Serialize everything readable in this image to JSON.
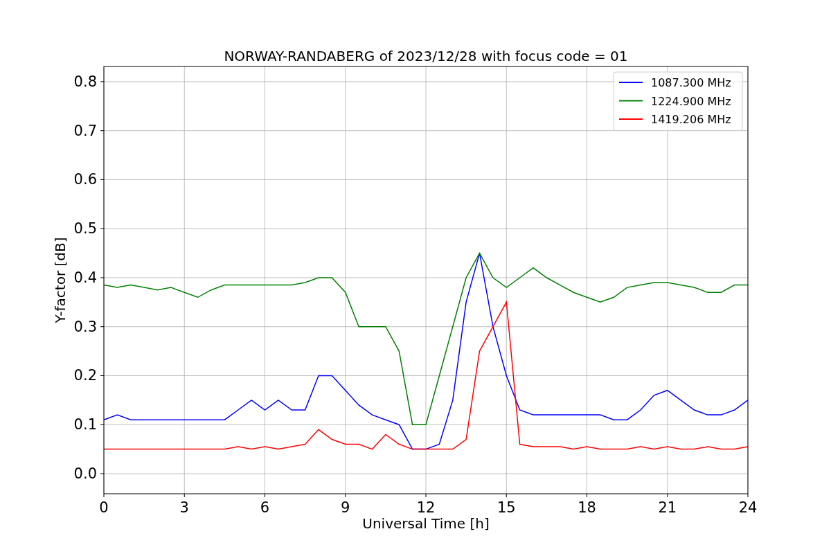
{
  "chart_data": {
    "type": "line",
    "title": "NORWAY-RANDABERG of 2023/12/28 with focus code = 01",
    "xlabel": "Universal Time [h]",
    "ylabel": "Y-factor [dB]",
    "x": [
      0,
      0.5,
      1,
      1.5,
      2,
      2.5,
      3,
      3.5,
      4,
      4.5,
      5,
      5.5,
      6,
      6.5,
      7,
      7.5,
      8,
      8.5,
      9,
      9.5,
      10,
      10.5,
      11,
      11.5,
      12,
      12.5,
      13,
      13.5,
      14,
      14.5,
      15,
      15.5,
      16,
      16.5,
      17,
      17.5,
      18,
      18.5,
      19,
      19.5,
      20,
      20.5,
      21,
      21.5,
      22,
      22.5,
      23,
      23.5,
      24
    ],
    "series": [
      {
        "name": "1087.300 MHz",
        "color": "#0000ff",
        "values": [
          0.11,
          0.12,
          0.11,
          0.11,
          0.11,
          0.11,
          0.11,
          0.11,
          0.11,
          0.11,
          0.13,
          0.15,
          0.13,
          0.15,
          0.13,
          0.13,
          0.2,
          0.2,
          0.17,
          0.14,
          0.12,
          0.11,
          0.1,
          0.05,
          0.05,
          0.06,
          0.15,
          0.35,
          0.45,
          0.3,
          0.2,
          0.13,
          0.12,
          0.12,
          0.12,
          0.12,
          0.12,
          0.12,
          0.11,
          0.11,
          0.13,
          0.16,
          0.17,
          0.15,
          0.13,
          0.12,
          0.12,
          0.13,
          0.15
        ]
      },
      {
        "name": "1224.900 MHz",
        "color": "#008000",
        "values": [
          0.385,
          0.38,
          0.385,
          0.38,
          0.375,
          0.38,
          0.37,
          0.36,
          0.375,
          0.385,
          0.385,
          0.385,
          0.385,
          0.385,
          0.385,
          0.39,
          0.4,
          0.4,
          0.37,
          0.3,
          0.3,
          0.3,
          0.25,
          0.1,
          0.1,
          0.2,
          0.3,
          0.4,
          0.45,
          0.4,
          0.38,
          0.4,
          0.42,
          0.4,
          0.385,
          0.37,
          0.36,
          0.35,
          0.36,
          0.38,
          0.385,
          0.39,
          0.39,
          0.385,
          0.38,
          0.37,
          0.37,
          0.385,
          0.385
        ]
      },
      {
        "name": "1419.206 MHz",
        "color": "#ff0000",
        "values": [
          0.05,
          0.05,
          0.05,
          0.05,
          0.05,
          0.05,
          0.05,
          0.05,
          0.05,
          0.05,
          0.055,
          0.05,
          0.055,
          0.05,
          0.055,
          0.06,
          0.09,
          0.07,
          0.06,
          0.06,
          0.05,
          0.08,
          0.06,
          0.05,
          0.05,
          0.05,
          0.05,
          0.07,
          0.25,
          0.3,
          0.35,
          0.06,
          0.055,
          0.055,
          0.055,
          0.05,
          0.055,
          0.05,
          0.05,
          0.05,
          0.055,
          0.05,
          0.055,
          0.05,
          0.05,
          0.055,
          0.05,
          0.05,
          0.055
        ]
      }
    ],
    "grid": true,
    "legend": "upper right",
    "xlim": [
      0,
      24
    ],
    "ylim": [
      -0.041,
      0.831
    ],
    "xticks": [
      0,
      3,
      6,
      9,
      12,
      15,
      18,
      21,
      24
    ],
    "yticks": [
      {
        "value": 0,
        "label": "0.0"
      },
      {
        "value": 0.1,
        "label": "0.1"
      },
      {
        "value": 0.2,
        "label": "0.2"
      },
      {
        "value": 0.3,
        "label": "0.3"
      },
      {
        "value": 0.4,
        "label": "0.4"
      },
      {
        "value": 0.5,
        "label": "0.5"
      },
      {
        "value": 0.6,
        "label": "0.6"
      },
      {
        "value": 0.7,
        "label": "0.7"
      },
      {
        "value": 0.8,
        "label": "0.8"
      }
    ]
  }
}
